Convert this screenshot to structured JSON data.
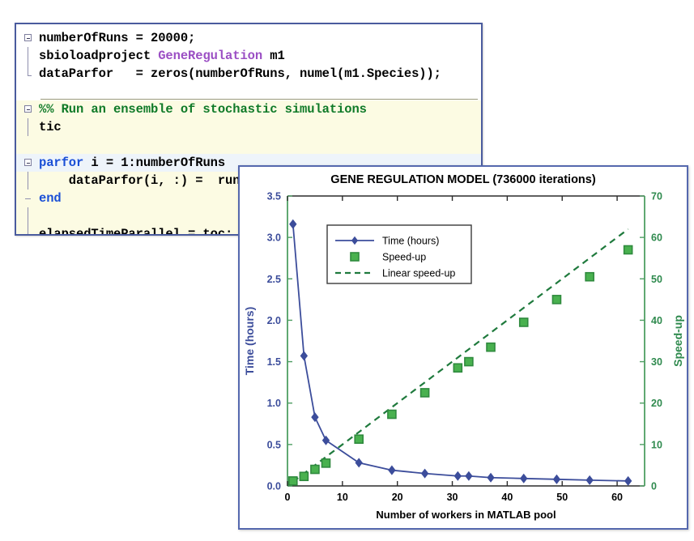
{
  "code_editor": {
    "lines": [
      {
        "indent": 0,
        "fold": "start",
        "tokens": [
          {
            "t": "numberOfRuns = 20000;",
            "c": "plain"
          }
        ]
      },
      {
        "indent": 0,
        "fold": "stem",
        "tokens": [
          {
            "t": "sbioloadproject ",
            "c": "plain"
          },
          {
            "t": "GeneRegulation",
            "c": "string"
          },
          {
            "t": " m1",
            "c": "plain"
          }
        ]
      },
      {
        "indent": 0,
        "fold": "end",
        "tokens": [
          {
            "t": "dataParfor   = zeros(numberOfRuns, numel(m1.Species));",
            "c": "plain"
          }
        ]
      },
      {
        "indent": 0,
        "fold": "none",
        "tokens": [
          {
            "t": "",
            "c": "plain"
          }
        ]
      },
      {
        "indent": 0,
        "fold": "start",
        "tokens": [
          {
            "t": "%% Run an ensemble of stochastic simulations",
            "c": "comment"
          }
        ]
      },
      {
        "indent": 0,
        "fold": "stem",
        "tokens": [
          {
            "t": "tic",
            "c": "plain"
          }
        ]
      },
      {
        "indent": 0,
        "fold": "none",
        "tokens": [
          {
            "t": "",
            "c": "plain"
          }
        ]
      },
      {
        "indent": 0,
        "fold": "start",
        "tokens": [
          {
            "t": "parfor",
            "c": "keyword"
          },
          {
            "t": " i = 1:numberOfRuns",
            "c": "plain"
          }
        ]
      },
      {
        "indent": 1,
        "fold": "stem",
        "tokens": [
          {
            "t": "    dataParfor(i, :) =  runSimBioModel();",
            "c": "plain"
          }
        ]
      },
      {
        "indent": 0,
        "fold": "tick",
        "tokens": [
          {
            "t": "end",
            "c": "keyword"
          }
        ]
      },
      {
        "indent": 0,
        "fold": "stem",
        "tokens": [
          {
            "t": "",
            "c": "plain"
          }
        ]
      },
      {
        "indent": 0,
        "fold": "end",
        "tokens": [
          {
            "t": "elapsedTimeParallel = toc;",
            "c": "plain"
          }
        ]
      }
    ],
    "colors": {
      "keyword": "#1a4fd6",
      "comment": "#0f7a28",
      "string": "#9b4fc4",
      "plain": "#000000",
      "cell_background": "#fcfbe3",
      "panel_border": "#4a5b9e"
    }
  },
  "chart_panel": {
    "border_color": "#5568ae"
  },
  "chart_data": {
    "type": "line",
    "title": "GENE REGULATION MODEL (736000 iterations)",
    "xlabel": "Number of workers in MATLAB pool",
    "ylabel": "Time (hours)",
    "y2label": "Speed-up",
    "xlim": [
      0,
      65
    ],
    "ylim": [
      0,
      3.5
    ],
    "y2lim": [
      0,
      70
    ],
    "xticks": [
      0,
      10,
      20,
      30,
      40,
      50,
      60
    ],
    "yticks": [
      0.0,
      0.5,
      1.0,
      1.5,
      2.0,
      2.5,
      3.0,
      3.5
    ],
    "yticklabels": [
      "0.0",
      "0.5",
      "1.0",
      "1.5",
      "2.0",
      "2.5",
      "3.0",
      "3.5"
    ],
    "y2ticks": [
      0,
      10,
      20,
      30,
      40,
      50,
      60,
      70
    ],
    "y2ticklabels": [
      "0",
      "10",
      "20",
      "30",
      "40",
      "50",
      "60",
      "70"
    ],
    "grid": false,
    "legend_position": "upper-left-inside",
    "x": [
      1,
      3,
      5,
      7,
      13,
      19,
      25,
      31,
      33,
      37,
      43,
      49,
      55,
      62
    ],
    "series": [
      {
        "name": "Time (hours)",
        "axis": "left",
        "style": "line-marker",
        "marker": "diamond",
        "color": "#3c4d9b",
        "values": [
          3.16,
          1.57,
          0.83,
          0.55,
          0.28,
          0.19,
          0.15,
          0.12,
          0.12,
          0.1,
          0.09,
          0.08,
          0.07,
          0.06
        ]
      },
      {
        "name": "Speed-up",
        "axis": "right",
        "style": "marker-only",
        "marker": "square",
        "color": "#49b14f",
        "values": [
          1.2,
          2.3,
          4.0,
          5.5,
          11.3,
          17.3,
          22.5,
          28.5,
          30.0,
          33.5,
          39.5,
          45.0,
          50.5,
          57.0
        ]
      },
      {
        "name": "Linear speed-up",
        "axis": "right",
        "style": "dashed-line",
        "color": "#1f7a3d",
        "x": [
          1,
          62
        ],
        "values": [
          1.0,
          62.0
        ]
      }
    ],
    "legend": [
      {
        "label": "Time (hours)",
        "marker": "diamond",
        "line": "solid",
        "color": "#3c4d9b"
      },
      {
        "label": "Speed-up",
        "marker": "square",
        "line": "none",
        "color": "#49b14f"
      },
      {
        "label": "Linear speed-up",
        "marker": "none",
        "line": "dashed",
        "color": "#1f7a3d"
      }
    ]
  }
}
